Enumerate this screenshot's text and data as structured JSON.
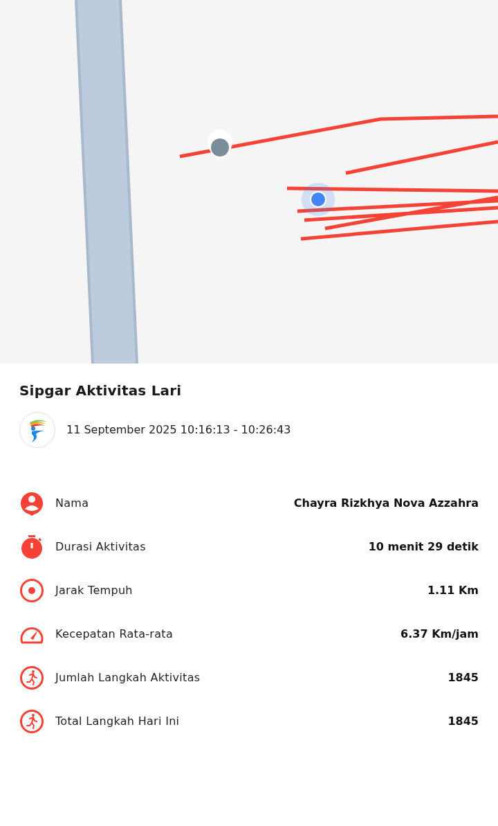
{
  "title": "Sipgar Aktivitas Lari",
  "session": {
    "time_range": "11 September 2025 10:16:13 - 10:26:43"
  },
  "stats": [
    {
      "kind": "person",
      "label": "Nama",
      "value": "Chayra Rizkhya Nova Azzahra"
    },
    {
      "kind": "timer",
      "label": "Durasi Aktivitas",
      "value": "10 menit 29 detik"
    },
    {
      "kind": "target",
      "label": "Jarak Tempuh",
      "value": "1.11 Km"
    },
    {
      "kind": "speed",
      "label": "Kecepatan Rata-rata",
      "value": "6.37 Km/jam"
    },
    {
      "kind": "runner",
      "label": "Jumlah Langkah Aktivitas",
      "value": "1845"
    },
    {
      "kind": "runner",
      "label": "Total Langkah Hari Ini",
      "value": "1845"
    }
  ]
}
